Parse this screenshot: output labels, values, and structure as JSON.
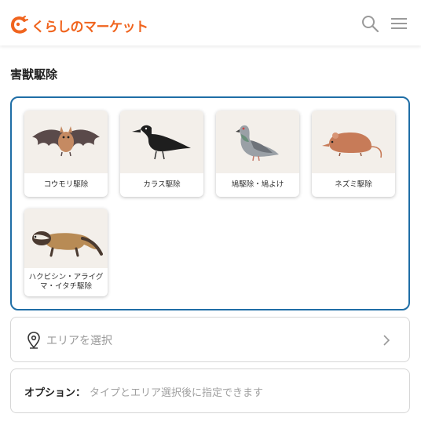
{
  "header": {
    "logo_text": "くらしのマーケット",
    "brand_color": "#f0641e",
    "icons": [
      "search-icon",
      "hamburger-menu-icon"
    ]
  },
  "section": {
    "title": "害獣駆除",
    "panel_border_color": "#1f6ea6"
  },
  "categories": [
    {
      "label": "コウモリ駆除",
      "icon": "bat-icon"
    },
    {
      "label": "カラス駆除",
      "icon": "crow-icon"
    },
    {
      "label": "鳩駆除・鳩よけ",
      "icon": "pigeon-icon"
    },
    {
      "label": "ネズミ駆除",
      "icon": "rat-icon"
    },
    {
      "label": "ハクビシン・アライグマ・イタチ駆除",
      "icon": "civet-icon"
    }
  ],
  "area": {
    "placeholder": "エリアを選択",
    "icon": "location-pin-icon",
    "chevron": "chevron-right-icon"
  },
  "options": {
    "label": "オプション：",
    "hint": "タイプとエリア選択後に指定できます"
  }
}
